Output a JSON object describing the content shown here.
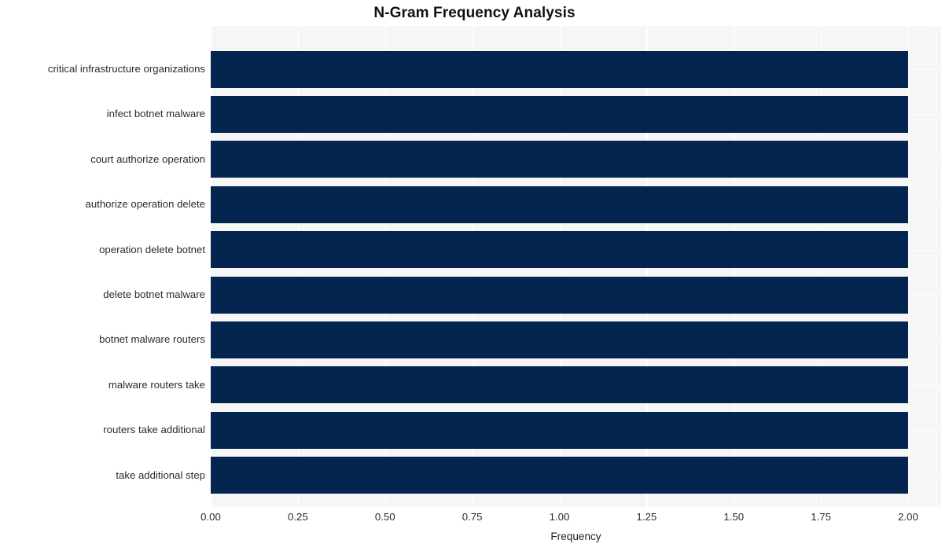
{
  "chart_data": {
    "type": "bar",
    "orientation": "horizontal",
    "title": "N-Gram Frequency Analysis",
    "xlabel": "Frequency",
    "ylabel": "",
    "categories": [
      "critical infrastructure organizations",
      "infect botnet malware",
      "court authorize operation",
      "authorize operation delete",
      "operation delete botnet",
      "delete botnet malware",
      "botnet malware routers",
      "malware routers take",
      "routers take additional",
      "take additional step"
    ],
    "values": [
      2,
      2,
      2,
      2,
      2,
      2,
      2,
      2,
      2,
      2
    ],
    "xlim": [
      0.0,
      2.0
    ],
    "xticks": [
      0.0,
      0.25,
      0.5,
      0.75,
      1.0,
      1.25,
      1.5,
      1.75,
      2.0
    ],
    "xtick_labels": [
      "0.00",
      "0.25",
      "0.50",
      "0.75",
      "1.00",
      "1.25",
      "1.50",
      "1.75",
      "2.00"
    ],
    "grid": true,
    "legend": null,
    "bar_color": "#04254f",
    "plot_background": "#f6f6f7",
    "figure_background": "#ffffff",
    "grid_color": "#ffffff",
    "text_color": "#2b2b2b"
  }
}
